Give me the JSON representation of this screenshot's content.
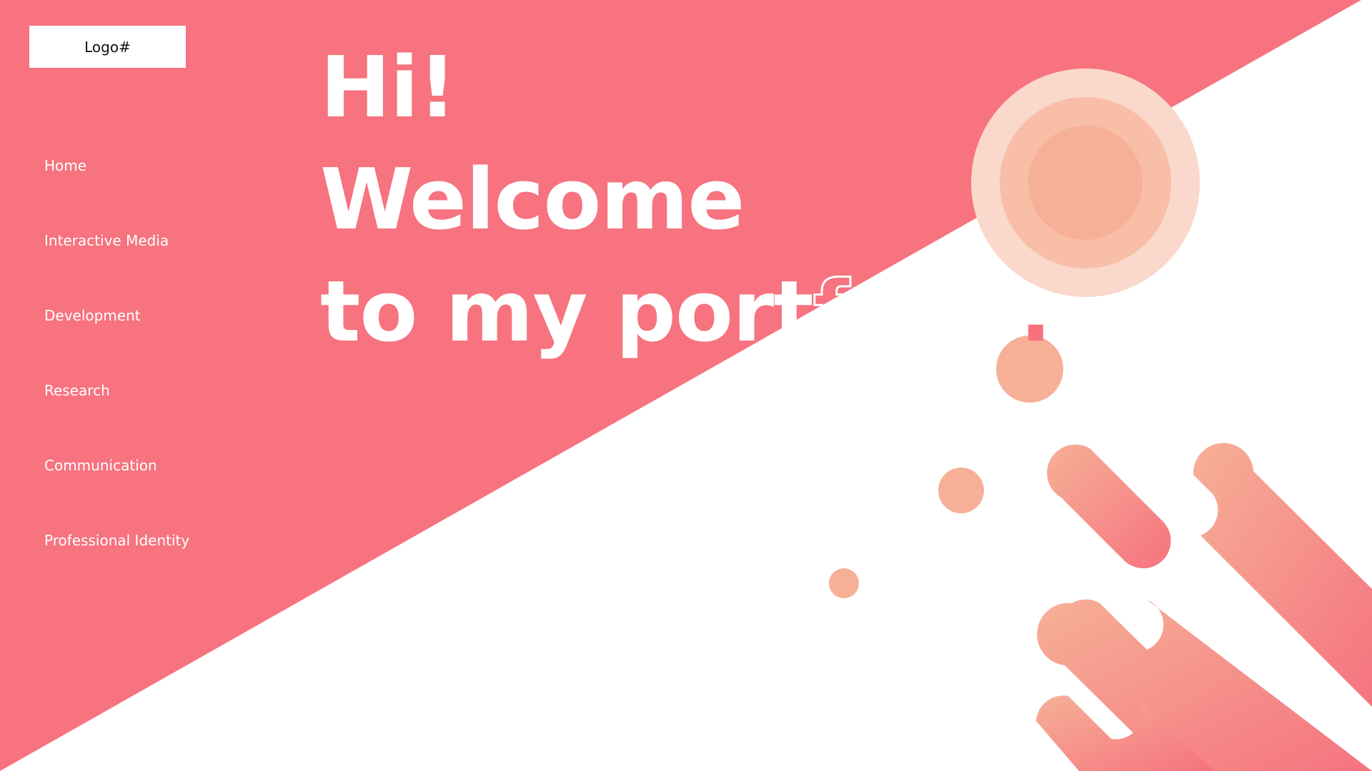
{
  "colors": {
    "primary": "#f6737f",
    "accent_peach": "#f6b097",
    "accent_light_peach": "#fad8cb",
    "background": "#ffffff",
    "text_light": "#ffffff"
  },
  "logo": {
    "label": "Logo#"
  },
  "nav": {
    "items": [
      {
        "label": "Home"
      },
      {
        "label": "Interactive Media"
      },
      {
        "label": "Development"
      },
      {
        "label": "Research"
      },
      {
        "label": "Communication"
      },
      {
        "label": "Professional Identity"
      }
    ]
  },
  "hero": {
    "line1": "Hi!",
    "line2": "Welcome",
    "line3_prefix": "to my port",
    "line3_outline": "folio",
    "line3_suffix": "."
  }
}
